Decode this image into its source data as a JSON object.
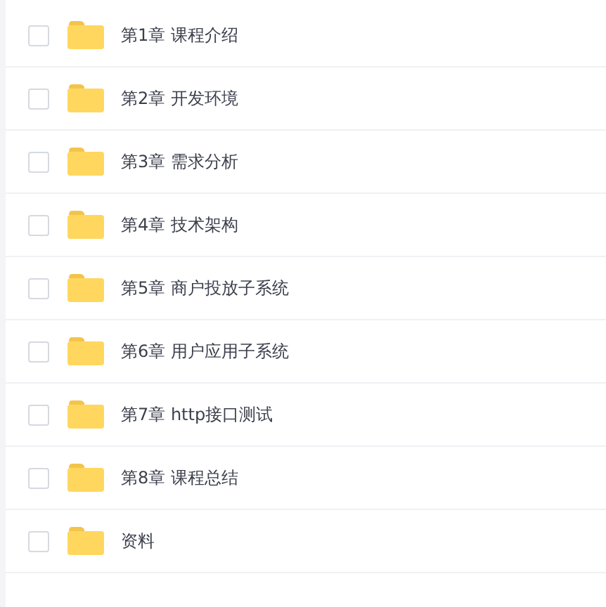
{
  "files": [
    {
      "name": "第1章 课程介绍",
      "checked": false
    },
    {
      "name": "第2章 开发环境",
      "checked": false
    },
    {
      "name": "第3章 需求分析",
      "checked": false
    },
    {
      "name": "第4章 技术架构",
      "checked": false
    },
    {
      "name": "第5章 商户投放子系统",
      "checked": false
    },
    {
      "name": "第6章 用户应用子系统",
      "checked": false
    },
    {
      "name": "第7章 http接口测试",
      "checked": false
    },
    {
      "name": "第8章 课程总结",
      "checked": false
    },
    {
      "name": "资料",
      "checked": false
    }
  ]
}
